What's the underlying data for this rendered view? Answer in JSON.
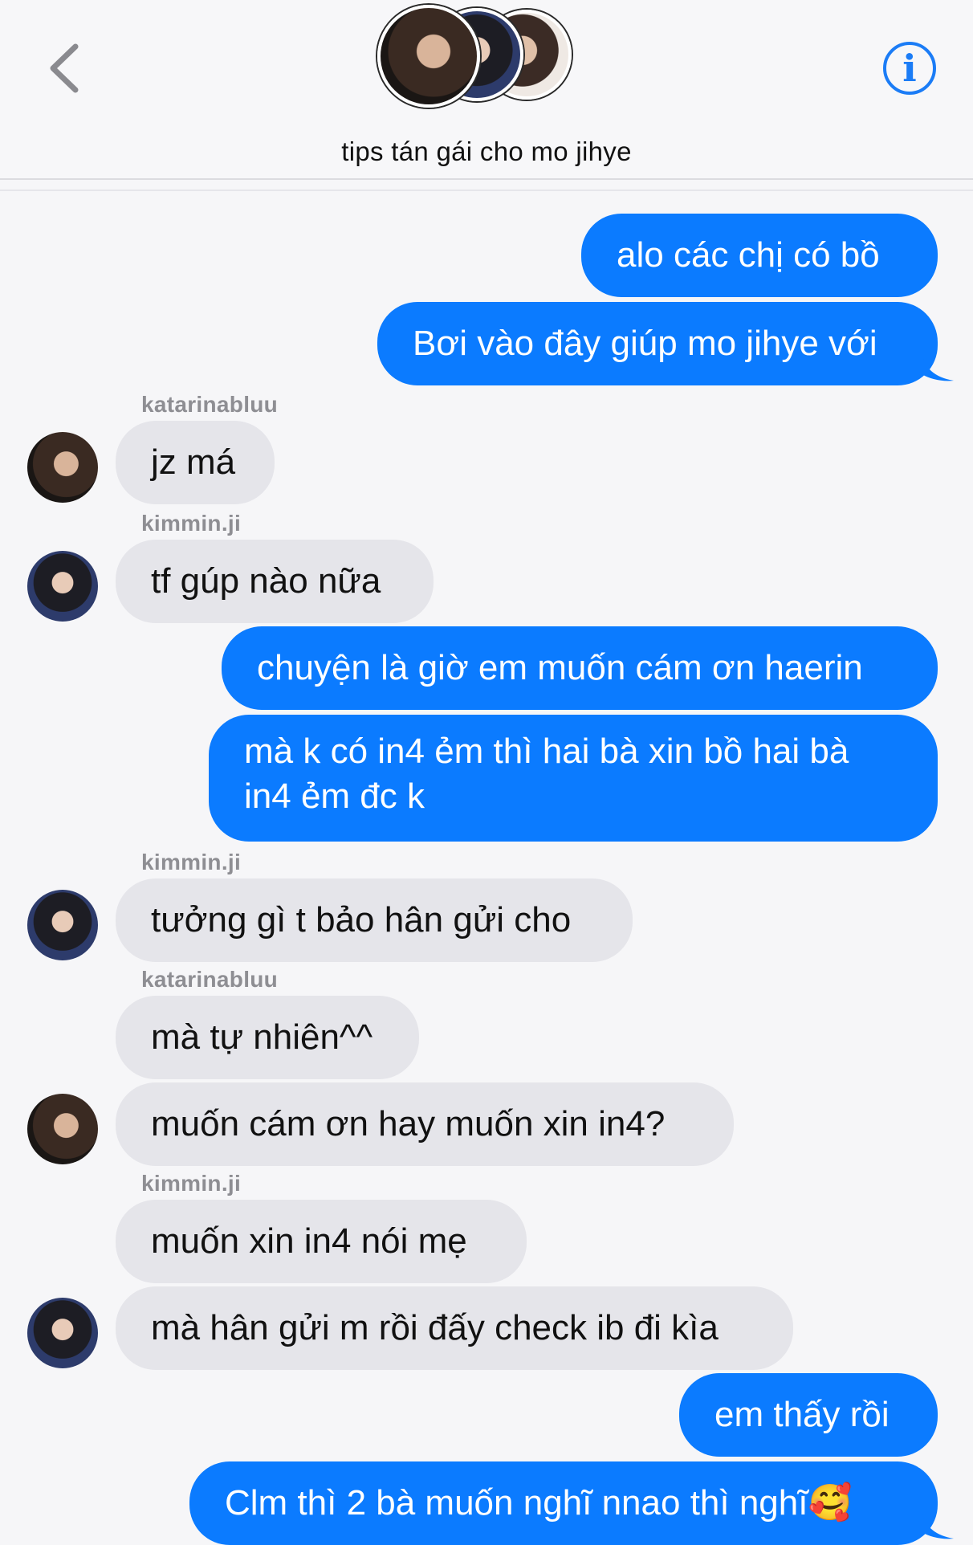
{
  "header": {
    "title": "tips tán gái cho mo jihye",
    "back_icon": "chevron-left-icon",
    "info_icon": "info-icon",
    "info_glyph": "i",
    "accent_color": "#1b7cf6"
  },
  "messages": [
    {
      "dir": "out",
      "text": "alo các chị có bồ"
    },
    {
      "dir": "out",
      "text": "Bơi vào đây giúp mo jihye với"
    },
    {
      "dir": "in",
      "sender": "katarinabluu",
      "text": "jz má"
    },
    {
      "dir": "in",
      "sender": "kimmin.ji",
      "text": "tf gúp nào nữa"
    },
    {
      "dir": "out",
      "text": "chuyện là giờ em muốn cám ơn haerin"
    },
    {
      "dir": "out",
      "line1": "mà k có in4 ẻm thì hai bà xin bồ hai bà",
      "line2": "in4 ẻm đc k"
    },
    {
      "dir": "in",
      "sender": "kimmin.ji",
      "text": "tưởng gì t bảo hân gửi cho"
    },
    {
      "dir": "in",
      "sender": "katarinabluu",
      "text": "mà tự nhiên^^"
    },
    {
      "dir": "in",
      "text": "muốn cám ơn hay muốn xin in4?"
    },
    {
      "dir": "in",
      "sender": "kimmin.ji",
      "text": "muốn xin in4 nói mẹ"
    },
    {
      "dir": "in",
      "text": "mà hân gửi m rồi đấy check ib đi kìa"
    },
    {
      "dir": "out",
      "text": "em thấy rồi"
    },
    {
      "dir": "out",
      "text": "Clm thì 2 bà muốn nghĩ nnao thì nghĩ🥰"
    }
  ],
  "colors": {
    "outgoing_bubble": "#0b7bff",
    "incoming_bubble": "#e5e5ea",
    "background": "#f6f6f8"
  }
}
